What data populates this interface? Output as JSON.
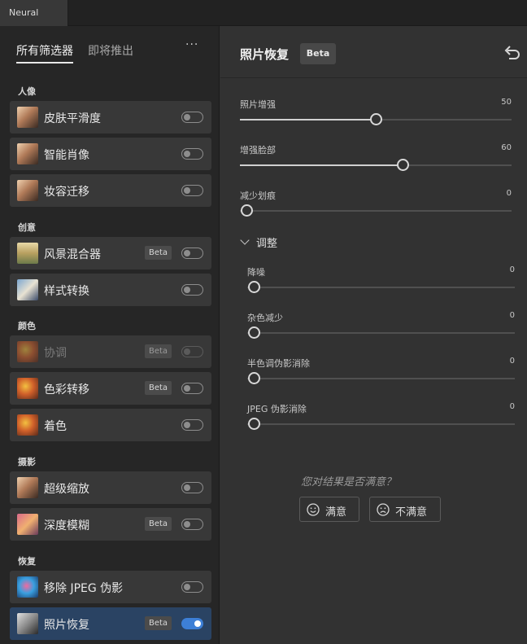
{
  "window": {
    "tab_title": "Neural Filters"
  },
  "left_panel": {
    "tabs": [
      {
        "label": "所有筛选器",
        "active": true
      },
      {
        "label": "即将推出",
        "active": false
      }
    ],
    "more_label": "···",
    "sections": [
      {
        "title": "人像",
        "items": [
          {
            "label": "皮肤平滑度",
            "beta": false,
            "on": false,
            "dim": false,
            "icon": "portrait-thumbnail"
          },
          {
            "label": "智能肖像",
            "beta": false,
            "on": false,
            "dim": false,
            "icon": "portrait-thumbnail"
          },
          {
            "label": "妆容迁移",
            "beta": false,
            "on": false,
            "dim": false,
            "icon": "portrait-thumbnail"
          }
        ]
      },
      {
        "title": "创意",
        "items": [
          {
            "label": "风景混合器",
            "beta": true,
            "on": false,
            "dim": false,
            "icon": "landscape-thumbnail"
          },
          {
            "label": "样式转换",
            "beta": false,
            "on": false,
            "dim": false,
            "icon": "style-thumbnail"
          }
        ]
      },
      {
        "title": "颜色",
        "items": [
          {
            "label": "协调",
            "beta": true,
            "on": false,
            "dim": true,
            "icon": "color-thumbnail"
          },
          {
            "label": "色彩转移",
            "beta": true,
            "on": false,
            "dim": false,
            "icon": "color-thumbnail"
          },
          {
            "label": "着色",
            "beta": false,
            "on": false,
            "dim": false,
            "icon": "color-thumbnail"
          }
        ]
      },
      {
        "title": "摄影",
        "items": [
          {
            "label": "超级缩放",
            "beta": false,
            "on": false,
            "dim": false,
            "icon": "portrait-thumbnail"
          },
          {
            "label": "深度模糊",
            "beta": true,
            "on": false,
            "dim": false,
            "icon": "depth-thumbnail"
          }
        ]
      },
      {
        "title": "恢复",
        "items": [
          {
            "label": "移除 JPEG 伪影",
            "beta": false,
            "on": false,
            "dim": false,
            "icon": "jpeg-thumbnail"
          },
          {
            "label": "照片恢复",
            "beta": true,
            "on": true,
            "dim": false,
            "selected": true,
            "icon": "photo-restore-thumbnail"
          }
        ]
      }
    ],
    "beta_label": "Beta"
  },
  "right_panel": {
    "title": "照片恢复",
    "beta_label": "Beta",
    "sliders": [
      {
        "label": "照片增强",
        "value": 50
      },
      {
        "label": "增强脸部",
        "value": 60
      },
      {
        "label": "减少划痕",
        "value": 0
      }
    ],
    "adjust": {
      "label": "调整",
      "sliders": [
        {
          "label": "降噪",
          "value": 0
        },
        {
          "label": "杂色减少",
          "value": 0
        },
        {
          "label": "半色调伪影消除",
          "value": 0
        },
        {
          "label": "JPEG 伪影消除",
          "value": 0
        }
      ]
    },
    "feedback": {
      "question": "您对结果是否满意？",
      "satisfied": "满意",
      "unsatisfied": "不满意"
    }
  },
  "colors": {
    "accent": "#3d7fd6",
    "selected_row": "#2a4363",
    "panel": "#323232",
    "sidebar": "#262626"
  }
}
